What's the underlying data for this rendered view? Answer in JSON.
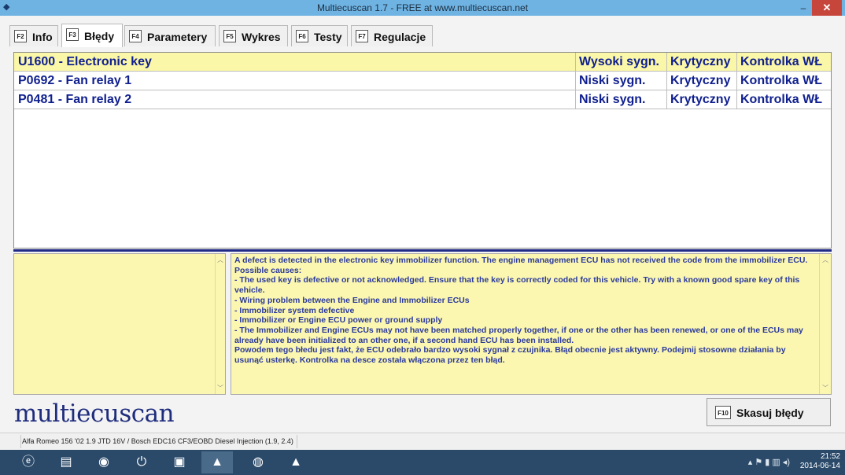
{
  "window": {
    "title": "Multiecuscan 1.7 - FREE at www.multiecuscan.net",
    "minimize": "–",
    "restore": "🗗",
    "close": "✕"
  },
  "tabs": [
    {
      "key": "F2",
      "label": "Info"
    },
    {
      "key": "F3",
      "label": "Błędy"
    },
    {
      "key": "F4",
      "label": "Parametery"
    },
    {
      "key": "F5",
      "label": "Wykres"
    },
    {
      "key": "F6",
      "label": "Testy"
    },
    {
      "key": "F7",
      "label": "Regulacje"
    }
  ],
  "errors": [
    {
      "code": "U1600 - Electronic key",
      "signal": "Wysoki sygn.",
      "severity": "Krytyczny",
      "lamp": "Kontrolka WŁ"
    },
    {
      "code": "P0692 - Fan relay 1",
      "signal": "Niski sygn.",
      "severity": "Krytyczny",
      "lamp": "Kontrolka WŁ"
    },
    {
      "code": "P0481 - Fan relay 2",
      "signal": "Niski sygn.",
      "severity": "Krytyczny",
      "lamp": "Kontrolka WŁ"
    }
  ],
  "description": [
    "A defect is detected in the electronic key immobilizer function. The engine management ECU has not received the code from the immobilizer ECU.",
    "Possible causes:",
    "- The used key is defective or not acknowledged. Ensure that the key is correctly coded for this vehicle. Try with a known good spare key of this vehicle.",
    "- Wiring problem between the Engine and Immobilizer ECUs",
    "- Immobilizer system defective",
    "- Immobilizer or Engine ECU power or ground supply",
    "- The Immobilizer and Engine ECUs may not have been matched properly together, if one or the other has been renewed, or one of the ECUs may already have been initialized to an other one, if a second hand ECU has been installed.",
    "Powodem tego błedu jest fakt, że ECU odebrało bardzo wysoki sygnał z czujnika. Błąd obecnie jest aktywny. Podejmij stosowne działania by usunąć usterkę. Kontrolka na desce została włączona przez ten błąd."
  ],
  "logo": "multiecuscan",
  "clear_button": {
    "key": "F10",
    "label": "Skasuj błędy"
  },
  "status": "Alfa Romeo 156 '02 1.9 JTD 16V / Bosch EDC16 CF3/EOBD Diesel Injection (1.9, 2.4)",
  "taskbar": {
    "time": "21:52",
    "date": "2014-06-14"
  }
}
